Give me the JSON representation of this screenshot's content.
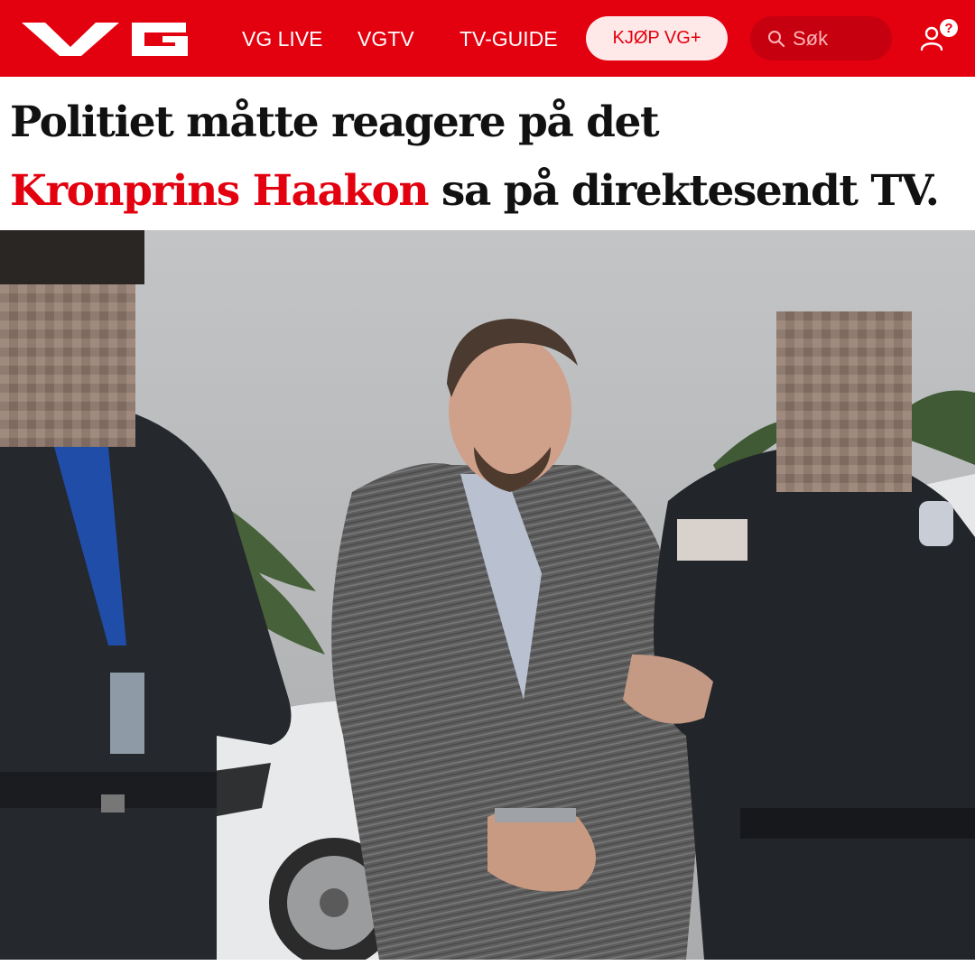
{
  "nav": {
    "brand": "VG",
    "links": [
      "VG LIVE",
      "VGTV",
      "TV-GUIDE"
    ],
    "buy_label": "KJØP VG+",
    "search_placeholder": "Søk",
    "notification_badge": "?"
  },
  "headline": {
    "line1": "Politiet måtte reagere på det",
    "line2_highlight": "Kronprins Haakon",
    "line2_rest": "sa på direktesendt TV."
  },
  "icons": {
    "search": "search-icon",
    "user": "user-icon",
    "badge": "question-badge-icon"
  },
  "colors": {
    "brand_red": "#e3000f",
    "headline_text": "#111111",
    "buy_button_bg": "#ffe8e8",
    "search_bg": "#c70010"
  }
}
